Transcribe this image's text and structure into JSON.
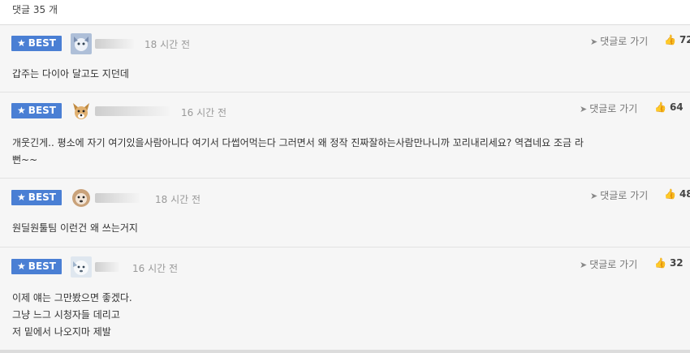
{
  "header": {
    "comment_count": "댓글 35 개"
  },
  "comments": [
    {
      "badge": "BEST",
      "avatar_icon": "dog-avatar-icon",
      "time": "18 시간 전",
      "reply_label": "댓글로 가기",
      "likes": "72",
      "lines": [
        "갑주는 다이아 달고도 지던데"
      ]
    },
    {
      "badge": "BEST",
      "avatar_icon": "dog-avatar-icon",
      "time": "16 시간 전",
      "reply_label": "댓글로 가기",
      "likes": "64",
      "lines": [
        "개웃긴게.. 평소에 자기 여기있을사람아니다 여기서 다썹어먹는다 그러면서 왜 정작 진짜잘하는사람만나니까 꼬리내리세요? 역겹네요 조금 라",
        "뻔~~"
      ]
    },
    {
      "badge": "BEST",
      "avatar_icon": "dog-avatar-icon",
      "time": "18 시간 전",
      "reply_label": "댓글로 가기",
      "likes": "48",
      "lines": [
        "원딜원툴팀 이런건 왜 쓰는거지"
      ]
    },
    {
      "badge": "BEST",
      "avatar_icon": "dog-avatar-icon",
      "time": "16 시간 전",
      "reply_label": "댓글로 가기",
      "likes": "32",
      "lines": [
        "이제 얘는 그만봤으면 좋겠다.",
        "그냥 느그 시청자들 데리고",
        "저 밑에서 나오지마 제발"
      ]
    }
  ],
  "colors": {
    "best_badge": "#4a7fd4",
    "comment_bg": "#f6f6f6"
  }
}
